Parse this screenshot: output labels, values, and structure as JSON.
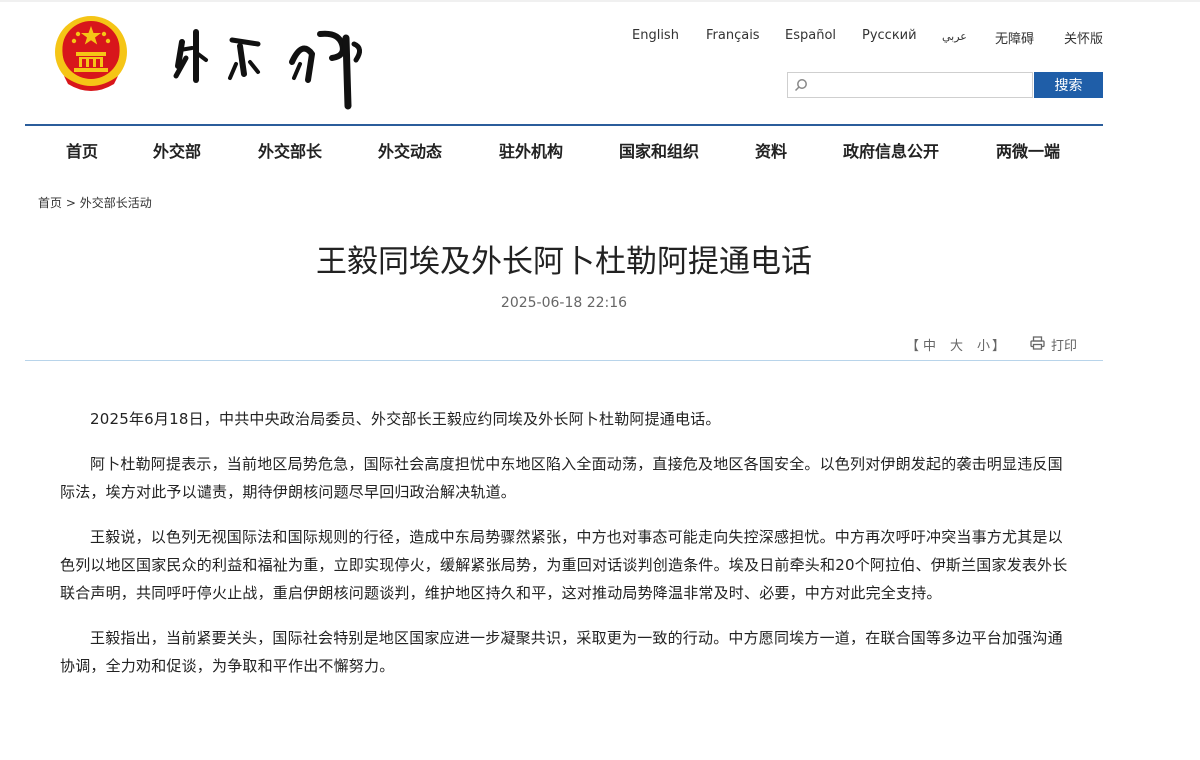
{
  "header": {
    "languages": [
      "English",
      "Français",
      "Español",
      "Русский",
      "عربي",
      "无障碍",
      "关怀版"
    ],
    "search": {
      "placeholder": "",
      "button_label": "搜索"
    }
  },
  "nav": {
    "items": [
      "首页",
      "外交部",
      "外交部长",
      "外交动态",
      "驻外机构",
      "国家和组织",
      "资料",
      "政府信息公开",
      "两微一端"
    ]
  },
  "breadcrumb": {
    "home": "首页",
    "separator": ">",
    "current": "外交部长活动"
  },
  "article": {
    "title": "王毅同埃及外长阿卜杜勒阿提通电话",
    "date": "2025-06-18 22:16",
    "font_controls": {
      "open": "【",
      "large": "中",
      "medium": "大",
      "small": "小",
      "close": "】"
    },
    "print_label": "打印",
    "paragraphs": [
      "2025年6月18日，中共中央政治局委员、外交部长王毅应约同埃及外长阿卜杜勒阿提通电话。",
      "阿卜杜勒阿提表示，当前地区局势危急，国际社会高度担忧中东地区陷入全面动荡，直接危及地区各国安全。以色列对伊朗发起的袭击明显违反国际法，埃方对此予以谴责，期待伊朗核问题尽早回归政治解决轨道。",
      "王毅说，以色列无视国际法和国际规则的行径，造成中东局势骤然紧张，中方也对事态可能走向失控深感担忧。中方再次呼吁冲突当事方尤其是以色列以地区国家民众的利益和福祉为重，立即实现停火，缓解紧张局势，为重回对话谈判创造条件。埃及日前牵头和20个阿拉伯、伊斯兰国家发表外长联合声明，共同呼吁停火止战，重启伊朗核问题谈判，维护地区持久和平，这对推动局势降温非常及时、必要，中方对此完全支持。",
      "王毅指出，当前紧要关头，国际社会特别是地区国家应进一步凝聚共识，采取更为一致的行动。中方愿同埃方一道，在联合国等多边平台加强沟通协调，全力劝和促谈，为争取和平作出不懈努力。"
    ]
  },
  "colors": {
    "nav_line": "#2b5d9b",
    "search_button": "#1f5ea8",
    "divider": "#b8d4ea",
    "emblem_red": "#d8161b",
    "emblem_gold": "#f5c516"
  }
}
